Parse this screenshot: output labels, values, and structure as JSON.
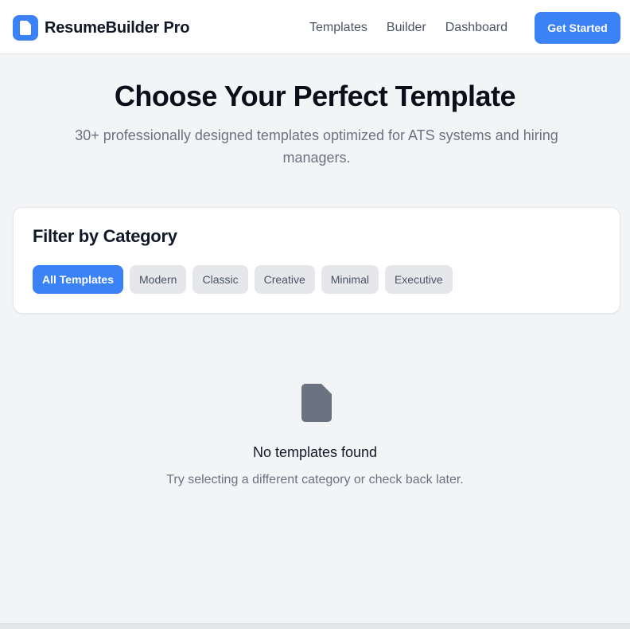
{
  "header": {
    "brand_name": "ResumeBuilder Pro",
    "brand_icon": "document-icon",
    "nav": [
      "Templates",
      "Builder",
      "Dashboard"
    ],
    "cta_label": "Get Started"
  },
  "hero": {
    "title": "Choose Your Perfect Template",
    "subtitle": "30+ professionally designed templates optimized for ATS systems and hiring managers."
  },
  "filter": {
    "title": "Filter by Category",
    "categories": [
      "All Templates",
      "Modern",
      "Classic",
      "Creative",
      "Minimal",
      "Executive"
    ],
    "active_category": "All Templates"
  },
  "empty_state": {
    "icon": "document-icon",
    "title": "No templates found",
    "message": "Try selecting a different category or check back later."
  },
  "colors": {
    "accent": "#3b82f6",
    "background": "#f3f4f6",
    "chip_inactive": "#e5e7eb",
    "empty_icon": "#6b7280"
  }
}
